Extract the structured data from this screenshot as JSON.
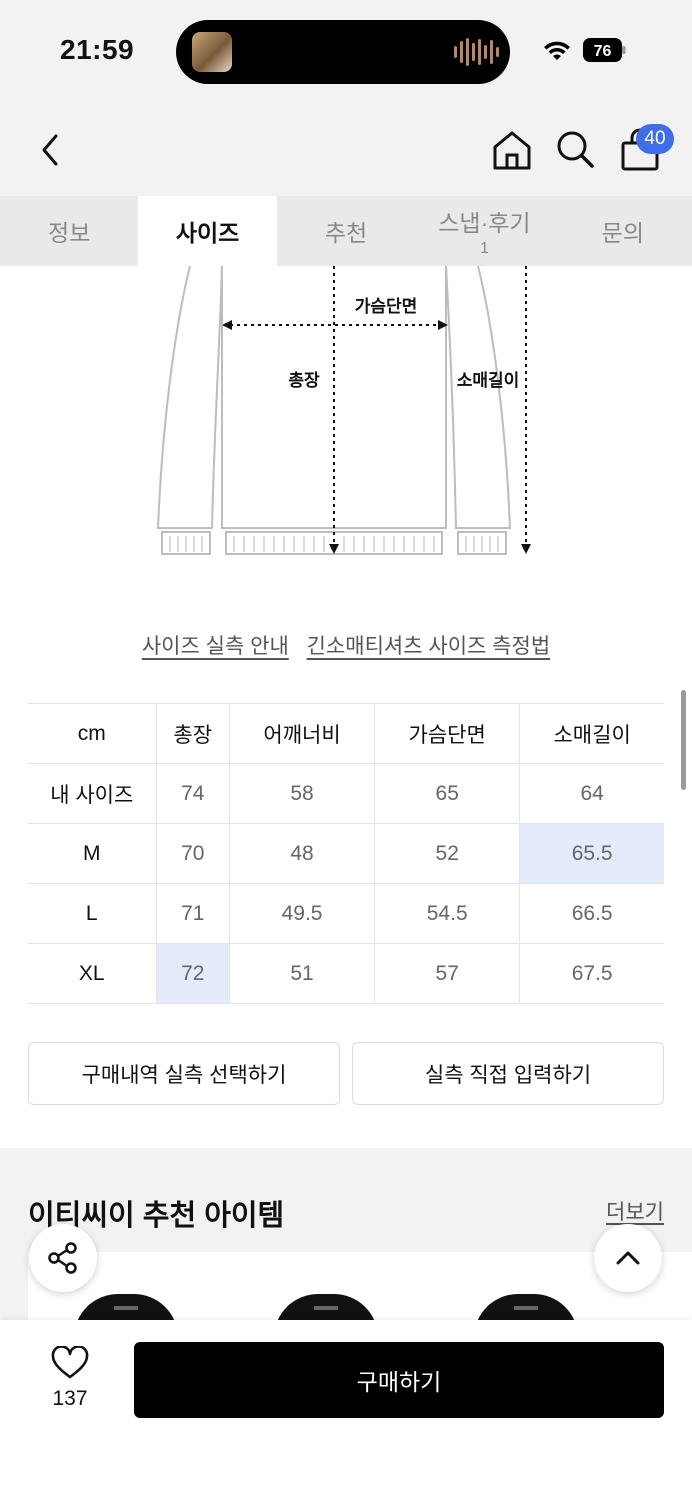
{
  "status_bar": {
    "time": "21:59",
    "battery": "76"
  },
  "header": {
    "cart_count": "40"
  },
  "tabs": [
    {
      "label": "정보",
      "sub": ""
    },
    {
      "label": "사이즈",
      "sub": ""
    },
    {
      "label": "추천",
      "sub": ""
    },
    {
      "label": "스냅·후기",
      "sub": "1"
    },
    {
      "label": "문의",
      "sub": ""
    }
  ],
  "diagram": {
    "chest_label": "가슴단면",
    "length_label": "총장",
    "sleeve_label": "소매길이"
  },
  "links": {
    "guide": "사이즈 실측 안내",
    "measure": "긴소매티셔츠 사이즈 측정법"
  },
  "size_table": {
    "headers": [
      "cm",
      "총장",
      "어깨너비",
      "가슴단면",
      "소매길이"
    ],
    "rows": [
      [
        "내 사이즈",
        "74",
        "58",
        "65",
        "64"
      ],
      [
        "M",
        "70",
        "48",
        "52",
        "65.5"
      ],
      [
        "L",
        "71",
        "49.5",
        "54.5",
        "66.5"
      ],
      [
        "XL",
        "72",
        "51",
        "57",
        "67.5"
      ]
    ]
  },
  "buttons": {
    "history": "구매내역 실측 선택하기",
    "manual": "실측 직접 입력하기"
  },
  "recommend": {
    "title": "이티씨이 추천 아이템",
    "more": "더보기"
  },
  "bottom": {
    "likes": "137",
    "buy": "구매하기"
  },
  "colors": {
    "accent": "#3f6ee8",
    "highlight": "#e4ebfa"
  }
}
